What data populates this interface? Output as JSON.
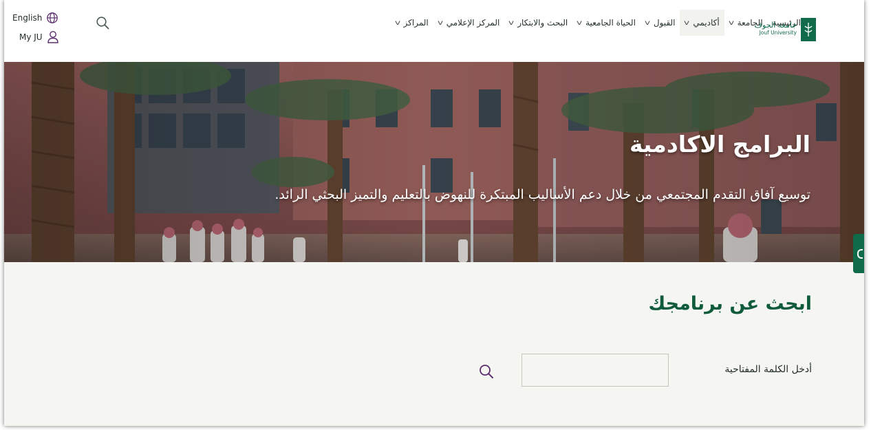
{
  "header": {
    "language_label": "English",
    "my_ju_label": "My JU",
    "logo": {
      "arabic": "جامعة الجوف",
      "english": "Jouf University"
    },
    "nav": [
      {
        "label": "الرئيسية",
        "has_dropdown": false
      },
      {
        "label": "الجامعة",
        "has_dropdown": true
      },
      {
        "label": "أكاديمي",
        "has_dropdown": true,
        "active": true
      },
      {
        "label": "القبول",
        "has_dropdown": true
      },
      {
        "label": "الحياة الجامعية",
        "has_dropdown": true
      },
      {
        "label": "البحث والابتكار",
        "has_dropdown": true
      },
      {
        "label": "المركز الإعلامي",
        "has_dropdown": true
      },
      {
        "label": "المراكز",
        "has_dropdown": true
      }
    ]
  },
  "hero": {
    "title": "البرامج الاكادمية",
    "subtitle": "توسيع آفاق التقدم المجتمعي من خلال دعم الأساليب المبتكرة للنهوض بالتعليم والتميز البحثي الرائد."
  },
  "search": {
    "title": "ابحث عن برنامجك",
    "keyword_label": "أدخل الكلمة المفتاحية",
    "keyword_value": ""
  },
  "colors": {
    "brand_green": "#0f6b4a",
    "title_green": "#0f5b3c",
    "icon_purple": "#5b2d6e",
    "page_bg": "#f5f5f2"
  },
  "icons": {
    "language": "globe-icon",
    "account": "user-icon",
    "search": "search-icon",
    "dropdown": "chevron-down-icon"
  }
}
